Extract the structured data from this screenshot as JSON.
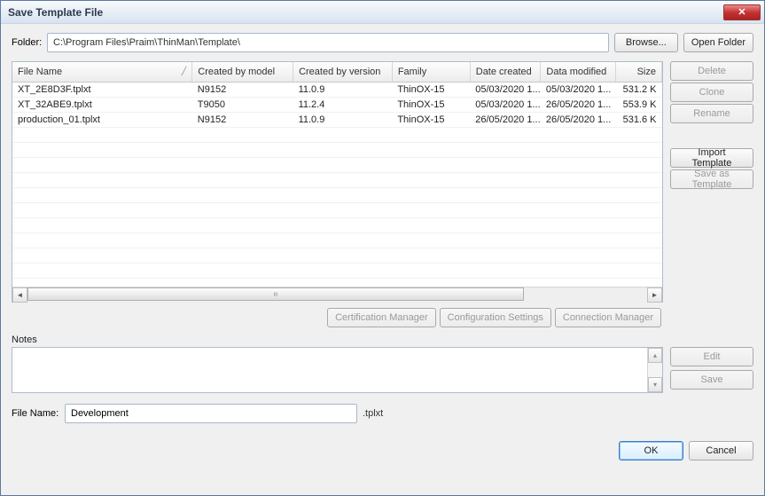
{
  "window": {
    "title": "Save Template File"
  },
  "folder": {
    "label": "Folder:",
    "path": "C:\\Program Files\\Praim\\ThinMan\\Template\\",
    "browse": "Browse...",
    "open": "Open Folder"
  },
  "columns": {
    "fname": "File Name",
    "model": "Created by model",
    "ver": "Created by version",
    "family": "Family",
    "created": "Date created",
    "modified": "Data modified",
    "size": "Size"
  },
  "rows": [
    {
      "fname": "XT_2E8D3F.tplxt",
      "model": "N9152",
      "ver": "11.0.9",
      "family": "ThinOX-15",
      "created": "05/03/2020 1...",
      "modified": "05/03/2020 1...",
      "size": "531.2 K"
    },
    {
      "fname": "XT_32ABE9.tplxt",
      "model": "T9050",
      "ver": "11.2.4",
      "family": "ThinOX-15",
      "created": "05/03/2020 1...",
      "modified": "26/05/2020 1...",
      "size": "553.9 K"
    },
    {
      "fname": "production_01.tplxt",
      "model": "N9152",
      "ver": "11.0.9",
      "family": "ThinOX-15",
      "created": "26/05/2020 1...",
      "modified": "26/05/2020 1...",
      "size": "531.6 K"
    }
  ],
  "side": {
    "delete": "Delete",
    "clone": "Clone",
    "rename": "Rename",
    "import": "Import Template",
    "saveas": "Save as Template"
  },
  "mid": {
    "cert": "Certification Manager",
    "conf": "Configuration Settings",
    "conn": "Connection Manager"
  },
  "notes": {
    "label": "Notes",
    "edit": "Edit",
    "save": "Save"
  },
  "filename": {
    "label": "File Name:",
    "value": "Development",
    "ext": ".tplxt"
  },
  "dialog": {
    "ok": "OK",
    "cancel": "Cancel"
  }
}
